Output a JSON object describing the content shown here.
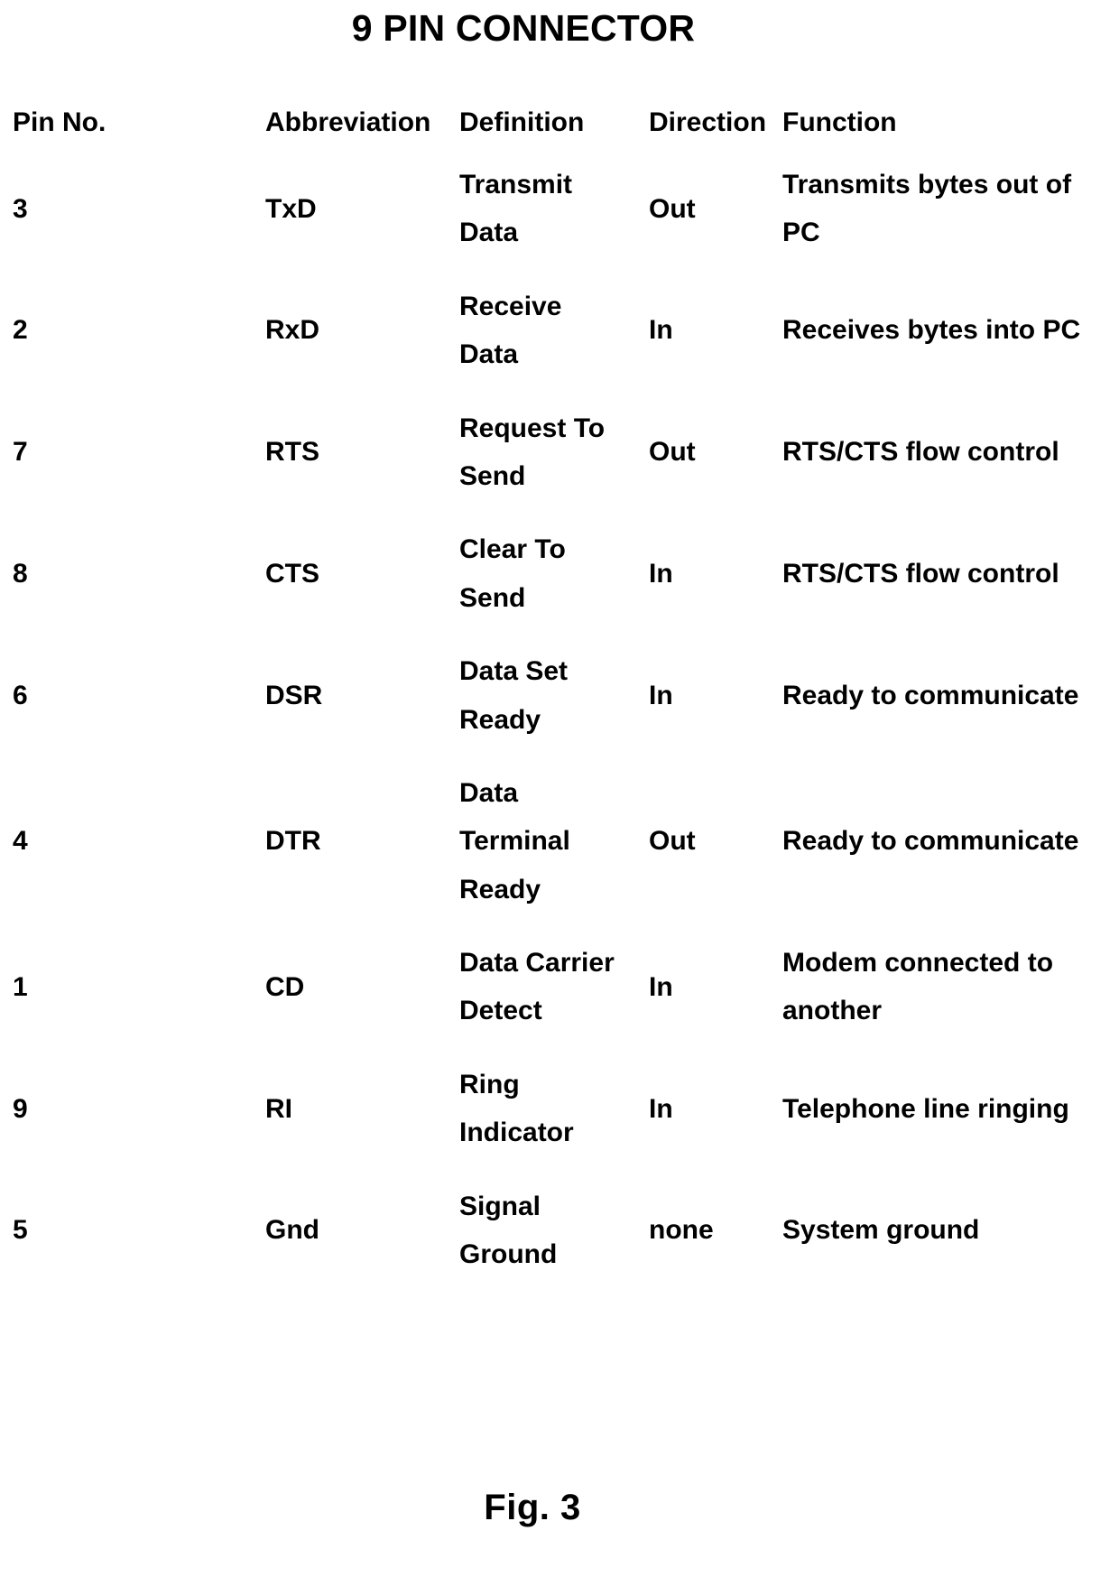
{
  "title": "9 PIN CONNECTOR",
  "figure_caption": "Fig. 3",
  "table": {
    "columns": [
      {
        "key": "pin",
        "label": "Pin No."
      },
      {
        "key": "abbr",
        "label": "Abbreviation"
      },
      {
        "key": "def",
        "label": "Definition"
      },
      {
        "key": "direction",
        "label": "Direction"
      },
      {
        "key": "function",
        "label": "Function"
      }
    ],
    "rows": [
      {
        "pin": "3",
        "abbr": "TxD",
        "def": "Transmit Data",
        "direction": "Out",
        "function": "Transmits bytes out of PC"
      },
      {
        "pin": "2",
        "abbr": "RxD",
        "def": "Receive Data",
        "direction": "In",
        "function": "Receives bytes into PC"
      },
      {
        "pin": "7",
        "abbr": "RTS",
        "def": "Request To Send",
        "direction": "Out",
        "function": "RTS/CTS flow control"
      },
      {
        "pin": "8",
        "abbr": "CTS",
        "def": "Clear To Send",
        "direction": "In",
        "function": "RTS/CTS flow control"
      },
      {
        "pin": "6",
        "abbr": "DSR",
        "def": "Data Set Ready",
        "direction": "In",
        "function": "Ready to communicate"
      },
      {
        "pin": "4",
        "abbr": "DTR",
        "def": "Data Terminal Ready",
        "direction": "Out",
        "function": "Ready to communicate"
      },
      {
        "pin": "1",
        "abbr": "CD",
        "def": "Data Carrier Detect",
        "direction": "In",
        "function": "Modem connected to another"
      },
      {
        "pin": "9",
        "abbr": "RI",
        "def": "Ring Indicator",
        "direction": "In",
        "function": "Telephone line ringing"
      },
      {
        "pin": "5",
        "abbr": "Gnd",
        "def": "Signal Ground",
        "direction": "none",
        "function": "System ground"
      }
    ]
  }
}
